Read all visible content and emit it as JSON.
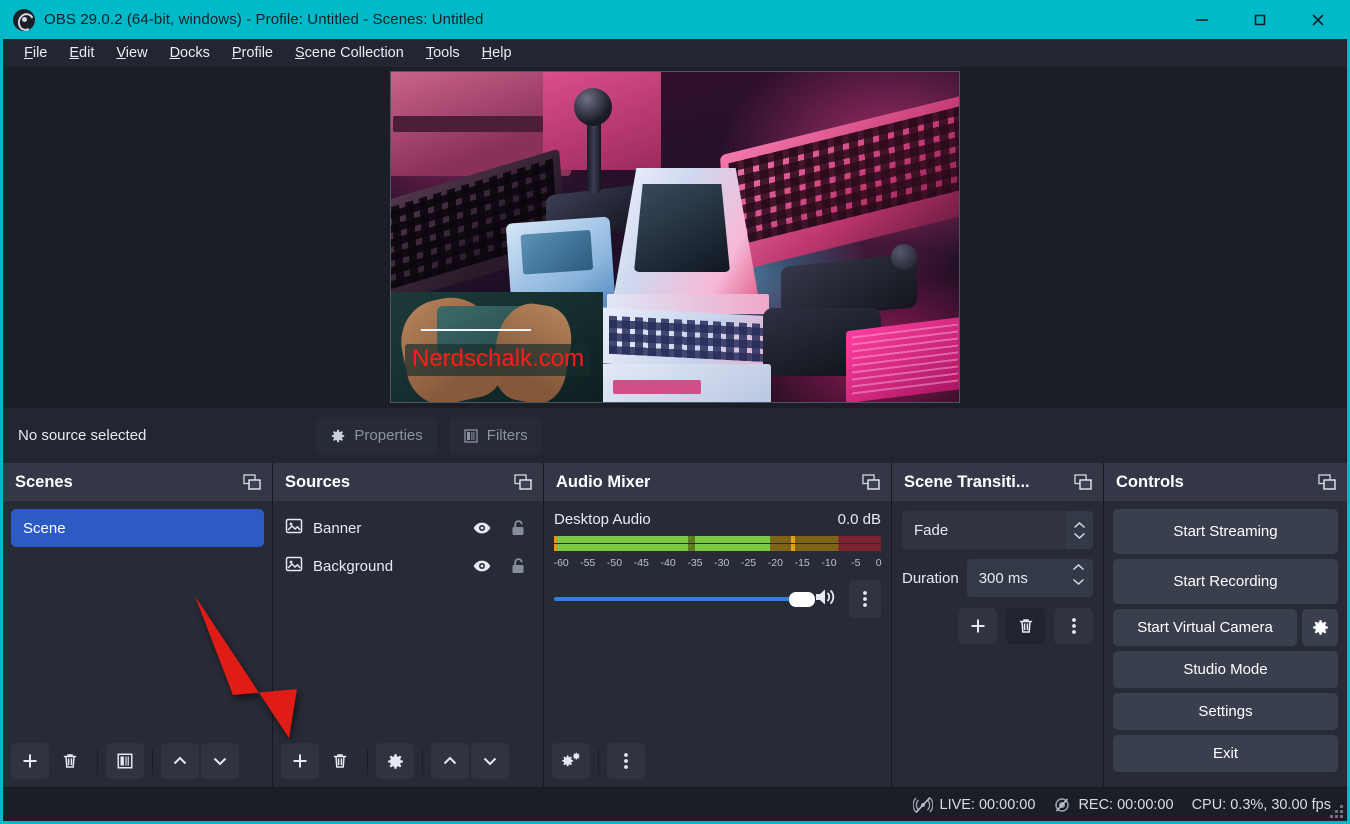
{
  "window": {
    "title": "OBS 29.0.2 (64-bit, windows) - Profile: Untitled - Scenes: Untitled",
    "logo_icon": "obs-logo-icon",
    "minimize_icon": "minimize-icon",
    "maximize_icon": "maximize-icon",
    "close_icon": "close-icon",
    "accent_color": "#00b9c9"
  },
  "menubar": {
    "items": [
      {
        "label": "File",
        "accel": "F"
      },
      {
        "label": "Edit",
        "accel": "E"
      },
      {
        "label": "View",
        "accel": "V"
      },
      {
        "label": "Docks",
        "accel": "D"
      },
      {
        "label": "Profile",
        "accel": "P"
      },
      {
        "label": "Scene Collection",
        "accel": "S"
      },
      {
        "label": "Tools",
        "accel": "T"
      },
      {
        "label": "Help",
        "accel": "H"
      }
    ]
  },
  "preview": {
    "banner_text": "Nerdschalk.com",
    "banner_text_color": "#fe1c18"
  },
  "source_toolbar": {
    "status": "No source selected",
    "properties_label": "Properties",
    "properties_icon": "gear-icon",
    "filters_label": "Filters",
    "filters_icon": "filters-icon"
  },
  "scenes": {
    "title": "Scenes",
    "float_icon": "undock-icon",
    "items": [
      {
        "label": "Scene",
        "selected": true
      }
    ],
    "toolbar": [
      {
        "icon": "plus-icon",
        "name": "add-scene-button"
      },
      {
        "icon": "trash-icon",
        "name": "remove-scene-button"
      },
      {
        "icon": "filters-icon",
        "name": "scene-filters-button"
      },
      {
        "icon": "chevron-up-icon",
        "name": "move-scene-up-button"
      },
      {
        "icon": "chevron-down-icon",
        "name": "move-scene-down-button"
      }
    ]
  },
  "sources": {
    "title": "Sources",
    "float_icon": "undock-icon",
    "items": [
      {
        "label": "Banner",
        "type_icon": "image-icon",
        "visible_icon": "eye-icon",
        "lock_icon": "unlock-icon"
      },
      {
        "label": "Background",
        "type_icon": "image-icon",
        "visible_icon": "eye-icon",
        "lock_icon": "unlock-icon"
      }
    ],
    "toolbar": [
      {
        "icon": "plus-icon",
        "name": "add-source-button"
      },
      {
        "icon": "trash-icon",
        "name": "remove-source-button"
      },
      {
        "icon": "gear-icon",
        "name": "source-properties-button"
      },
      {
        "icon": "chevron-up-icon",
        "name": "move-source-up-button"
      },
      {
        "icon": "chevron-down-icon",
        "name": "move-source-down-button"
      }
    ]
  },
  "audio_mixer": {
    "title": "Audio Mixer",
    "float_icon": "undock-icon",
    "channel_name": "Desktop Audio",
    "db_value": "0.0 dB",
    "meter_ticks": [
      "-60",
      "-55",
      "-50",
      "-45",
      "-40",
      "-35",
      "-30",
      "-25",
      "-20",
      "-15",
      "-10",
      "-5",
      "0"
    ],
    "meter_level_pct": 41,
    "meter_peak_pct": 66,
    "volume_pct": 96,
    "volume_icon": "speaker-icon",
    "options_icon": "kebab-icon",
    "toolbar": [
      {
        "icon": "advanced-audio-icon",
        "name": "advanced-audio-properties-button"
      },
      {
        "icon": "kebab-icon",
        "name": "audio-mixer-menu-button"
      }
    ]
  },
  "scene_transitions": {
    "title": "Scene Transiti...",
    "float_icon": "undock-icon",
    "transition_value": "Fade",
    "duration_label": "Duration",
    "duration_value": "300 ms",
    "buttons": [
      {
        "icon": "plus-icon",
        "name": "add-transition-button"
      },
      {
        "icon": "trash-icon",
        "name": "remove-transition-button"
      },
      {
        "icon": "kebab-icon",
        "name": "transition-properties-button"
      }
    ]
  },
  "controls": {
    "title": "Controls",
    "float_icon": "undock-icon",
    "start_streaming": "Start Streaming",
    "start_recording": "Start Recording",
    "start_virtual_camera": "Start Virtual Camera",
    "virtual_camera_config_icon": "gear-icon",
    "studio_mode": "Studio Mode",
    "settings": "Settings",
    "exit": "Exit"
  },
  "statusbar": {
    "live_icon": "stream-off-icon",
    "live": "LIVE: 00:00:00",
    "rec_icon": "record-off-icon",
    "rec": "REC: 00:00:00",
    "cpu": "CPU: 0.3%, 30.00 fps",
    "grip_icon": "resize-grip-icon"
  },
  "annotation": {
    "arrow_icon": "red-arrow-icon",
    "arrow_color": "#e01b16"
  }
}
